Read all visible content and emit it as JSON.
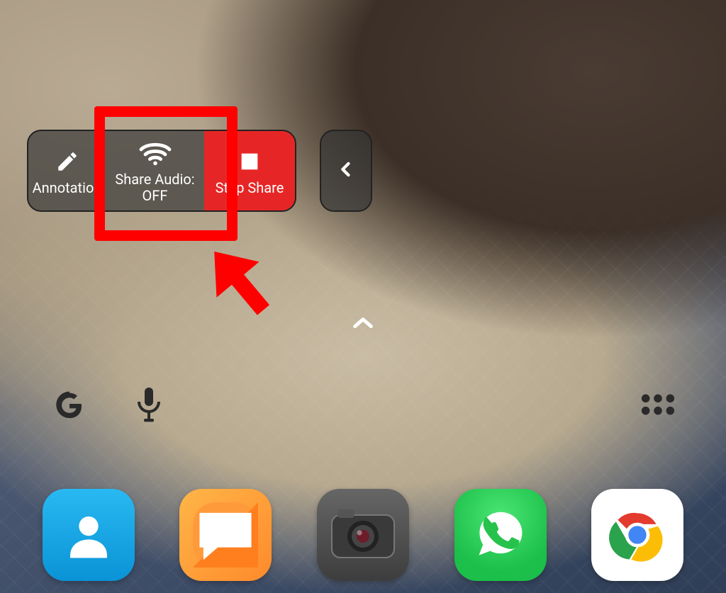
{
  "share_toolbar": {
    "annotation_label": "Annotation",
    "share_audio_label": "Share Audio:\nOFF",
    "stop_share_label": "Stop Share"
  },
  "drawer_glyph": "^",
  "highlight": {
    "color": "#ff0000"
  },
  "quick": {
    "google_name": "google-search",
    "mic_name": "voice-search",
    "drawer_name": "app-drawer"
  },
  "dock": {
    "items": [
      {
        "name": "contacts-app"
      },
      {
        "name": "messages-app"
      },
      {
        "name": "camera-app"
      },
      {
        "name": "whatsapp-app"
      },
      {
        "name": "chrome-app"
      }
    ]
  }
}
